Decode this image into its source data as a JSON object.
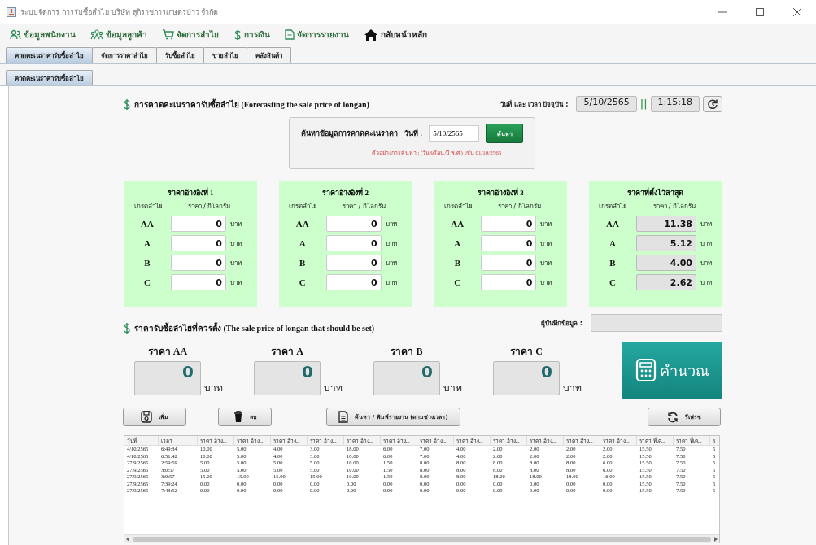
{
  "window": {
    "title": "ระบบจัดการ การรับซื้อลำไย บริษัท สุกิราชการเกษตรป่าว จำกัด"
  },
  "menu": [
    {
      "label": "ข้อมูลพนักงาน",
      "kind": "person"
    },
    {
      "label": "ข้อมูลลูกค้า",
      "kind": "group"
    },
    {
      "label": "จัดการลำไย",
      "kind": "cart"
    },
    {
      "label": "การเงิน",
      "kind": "dollar"
    },
    {
      "label": "จัดการรายงาน",
      "kind": "document"
    },
    {
      "label": "กลับหน้าหลัก",
      "kind": "home"
    }
  ],
  "tabs": [
    {
      "label": "คาดคะเนราคารับซื้อลำไย",
      "selected": true
    },
    {
      "label": "จัดการราคาลำไย",
      "selected": false
    },
    {
      "label": "รับซื้อลำไย",
      "selected": false
    },
    {
      "label": "ขายลำไย",
      "selected": false
    },
    {
      "label": "คลังสินค้า",
      "selected": false
    }
  ],
  "subtabs": [
    {
      "label": "คาดคะเนราคารับซื้อลำไย",
      "selected": true
    }
  ],
  "header": {
    "title": "การคาดคะเนราคารับซื้อลำไย (Forecasting the sale price of longan)",
    "datetime_label": "วันที่ และ เวลา ปัจจุบัน :",
    "date": "5/10/2565",
    "separator": "||",
    "time": "1:15:18"
  },
  "search": {
    "label": "ค้นหาข้อมูลการคาดคะเนราคา",
    "date_label": "วันที่ :",
    "date_value": "5/10/2565",
    "button": "ค้นหา",
    "hint": "ตัวอย่างการค้นหา : (วัน/เดือน/ปี พ.ศ.) เช่น 01/10/2565"
  },
  "panels": [
    {
      "title": "ราคาอ้างอิงที่ 1",
      "grade_header": "เกรดลำไย",
      "price_header": "ราคา / กิโลกรัม",
      "readonly": false,
      "rows": [
        {
          "grade": "AA",
          "value": "0",
          "unit": "บาท"
        },
        {
          "grade": "A",
          "value": "0",
          "unit": "บาท"
        },
        {
          "grade": "B",
          "value": "0",
          "unit": "บาท"
        },
        {
          "grade": "C",
          "value": "0",
          "unit": "บาท"
        }
      ]
    },
    {
      "title": "ราคาอ้างอิงที่ 2",
      "grade_header": "เกรดลำไย",
      "price_header": "ราคา / กิโลกรัม",
      "readonly": false,
      "rows": [
        {
          "grade": "AA",
          "value": "0",
          "unit": "บาท"
        },
        {
          "grade": "A",
          "value": "0",
          "unit": "บาท"
        },
        {
          "grade": "B",
          "value": "0",
          "unit": "บาท"
        },
        {
          "grade": "C",
          "value": "0",
          "unit": "บาท"
        }
      ]
    },
    {
      "title": "ราคาอ้างอิงที่ 3",
      "grade_header": "เกรดลำไย",
      "price_header": "ราคา / กิโลกรัม",
      "readonly": false,
      "rows": [
        {
          "grade": "AA",
          "value": "0",
          "unit": "บาท"
        },
        {
          "grade": "A",
          "value": "0",
          "unit": "บาท"
        },
        {
          "grade": "B",
          "value": "0",
          "unit": "บาท"
        },
        {
          "grade": "C",
          "value": "0",
          "unit": "บาท"
        }
      ]
    },
    {
      "title": "ราคาที่ตั้งไว้ล่าสุด",
      "grade_header": "เกรดลำไย",
      "price_header": "ราคา / กิโลกรัม",
      "readonly": true,
      "rows": [
        {
          "grade": "AA",
          "value": "11.38",
          "unit": "บาท"
        },
        {
          "grade": "A",
          "value": "5.12",
          "unit": "บาท"
        },
        {
          "grade": "B",
          "value": "4.00",
          "unit": "บาท"
        },
        {
          "grade": "C",
          "value": "2.62",
          "unit": "บาท"
        }
      ]
    }
  ],
  "suggested": {
    "title": "ราคารับซื้อลำไยที่ควรตั้ง (The sale price of longan that should be set)",
    "recorder_label": "ผู้บันทึกข้อมูล :",
    "prices": [
      {
        "label": "ราคา AA",
        "value": "0",
        "unit": "บาท"
      },
      {
        "label": "ราคา A",
        "value": "0",
        "unit": "บาท"
      },
      {
        "label": "ราคา B",
        "value": "0",
        "unit": "บาท"
      },
      {
        "label": "ราคา C",
        "value": "0",
        "unit": "บาท"
      }
    ],
    "calculate": "คำนวณ"
  },
  "buttons": [
    {
      "label": "เพิ่ม",
      "kind": "save"
    },
    {
      "label": "ลบ",
      "kind": "trash"
    },
    {
      "label": "ค้นหา / พิมพ์รายงาน (ตามช่วงเวลา)",
      "kind": "document"
    },
    {
      "label": "รีเฟรช",
      "kind": "refresh"
    }
  ],
  "table": {
    "columns": [
      "วันที่",
      "เวลา",
      "ราคา อ้าง...",
      "ราคา อ้าง...",
      "ราคา อ้าง...",
      "ราคา อ้าง...",
      "ราคา อ้าง...",
      "ราคา อ้าง...",
      "ราคา อ้าง...",
      "ราคา อ้าง...",
      "ราคา อ้าง...",
      "ราคา อ้าง...",
      "ราคา อ้าง...",
      "ราคา อ้าง...",
      "ราคา ที่เค...",
      "ราคา ที่เค...",
      "ร"
    ],
    "rows": [
      [
        "4/10/2565",
        "6:49:34",
        "10.00",
        "5.00",
        "4.00",
        "3.00",
        "18.00",
        "6.00",
        "7.00",
        "4.00",
        "2.00",
        "2.00",
        "2.00",
        "2.00",
        "15.50",
        "7.50",
        "5"
      ],
      [
        "4/10/2565",
        "6:51:42",
        "10.00",
        "5.00",
        "4.00",
        "3.00",
        "18.00",
        "6.00",
        "7.00",
        "4.00",
        "2.00",
        "2.00",
        "2.00",
        "2.00",
        "15.50",
        "7.50",
        "5"
      ],
      [
        "27/9/2565",
        "2:59:59",
        "5.00",
        "5.00",
        "5.00",
        "5.00",
        "10.00",
        "1.50",
        "8.00",
        "8.00",
        "8.00",
        "8.00",
        "8.00",
        "6.00",
        "15.50",
        "7.50",
        "5"
      ],
      [
        "27/9/2565",
        "3:0:57",
        "5.00",
        "5.00",
        "5.00",
        "5.00",
        "10.00",
        "1.50",
        "8.00",
        "8.00",
        "8.00",
        "8.00",
        "8.00",
        "6.00",
        "15.50",
        "7.50",
        "5"
      ],
      [
        "27/9/2565",
        "3:0:57",
        "15.00",
        "15.00",
        "15.00",
        "15.00",
        "10.00",
        "1.50",
        "8.00",
        "8.00",
        "18.00",
        "18.00",
        "18.00",
        "16.00",
        "15.50",
        "7.50",
        "5"
      ],
      [
        "27/9/2565",
        "7:39:24",
        "0.00",
        "0.00",
        "0.00",
        "0.00",
        "0.00",
        "0.00",
        "0.00",
        "0.00",
        "0.00",
        "0.00",
        "0.00",
        "0.00",
        "15.50",
        "7.50",
        "5"
      ],
      [
        "27/9/2565",
        "7:43:52",
        "0.00",
        "0.00",
        "0.00",
        "0.00",
        "0.00",
        "0.00",
        "0.00",
        "0.00",
        "0.00",
        "0.00",
        "0.00",
        "0.00",
        "15.50",
        "7.50",
        "5"
      ]
    ]
  }
}
